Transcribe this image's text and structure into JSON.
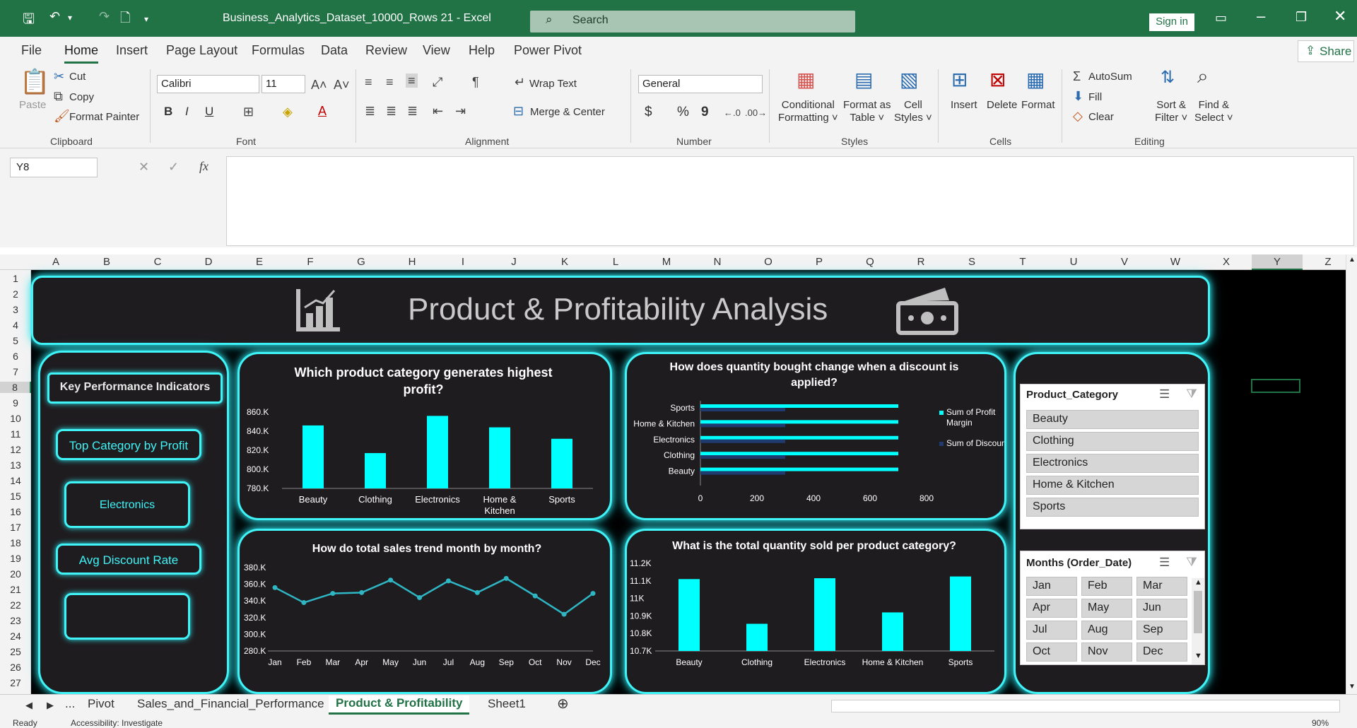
{
  "window": {
    "title": "Business_Analytics_Dataset_10000_Rows 21  -  Excel",
    "search": "Search",
    "signin": "Sign in",
    "share": "Share"
  },
  "menu": [
    "File",
    "Home",
    "Insert",
    "Page Layout",
    "Formulas",
    "Data",
    "Review",
    "View",
    "Help",
    "Power Pivot"
  ],
  "ribbon": {
    "clipboard": {
      "paste": "Paste",
      "cut": "Cut",
      "copy": "Copy",
      "format_painter": "Format Painter",
      "label": "Clipboard"
    },
    "font": {
      "name": "Calibri",
      "size": "11",
      "label": "Font",
      "bold": "B",
      "italic": "I",
      "underline": "U"
    },
    "alignment": {
      "wrap": "Wrap Text",
      "merge": "Merge & Center",
      "label": "Alignment"
    },
    "number": {
      "format": "General",
      "currency": "$",
      "percent": "%",
      "comma": "9",
      "label": "Number"
    },
    "styles": {
      "conditional": "Conditional",
      "conditional2": "Formatting",
      "format_as": "Format as",
      "format_as2": "Table",
      "cell_styles": "Cell",
      "cell_styles2": "Styles",
      "label": "Styles"
    },
    "cells": {
      "insert": "Insert",
      "delete": "Delete",
      "format": "Format",
      "label": "Cells"
    },
    "editing": {
      "autosum": "AutoSum",
      "fill": "Fill",
      "clear": "Clear",
      "sort": "Sort &",
      "sort2": "Filter",
      "find": "Find &",
      "find2": "Select",
      "label": "Editing"
    }
  },
  "namebox": "Y8",
  "fx": "fx",
  "columns": [
    "A",
    "B",
    "C",
    "D",
    "E",
    "F",
    "G",
    "H",
    "I",
    "J",
    "K",
    "L",
    "M",
    "N",
    "O",
    "P",
    "Q",
    "R",
    "S",
    "T",
    "U",
    "V",
    "W",
    "X",
    "Y",
    "Z"
  ],
  "rows": [
    "1",
    "2",
    "3",
    "4",
    "5",
    "6",
    "7",
    "8",
    "9",
    "10",
    "11",
    "12",
    "13",
    "14",
    "15",
    "16",
    "17",
    "18",
    "19",
    "20",
    "21",
    "22",
    "23",
    "24",
    "25",
    "26",
    "27"
  ],
  "dashboard": {
    "title": "Product & Profitability Analysis",
    "kpi_header": "Key Performance Indicators",
    "kpi1_label": "Top Category by Profit",
    "kpi1_value": "Electronics",
    "kpi2_label": "Avg Discount Rate",
    "kpi2_value": ""
  },
  "chart_data": [
    {
      "type": "bar",
      "title": "Which product category generates highest profit?",
      "categories": [
        "Beauty",
        "Clothing",
        "Electronics",
        "Home & Kitchen",
        "Sports"
      ],
      "values": [
        846000,
        817000,
        856000,
        844000,
        832000
      ],
      "yticks": [
        "860.K",
        "840.K",
        "820.K",
        "800.K",
        "780.K"
      ],
      "ylim": [
        780000,
        860000
      ],
      "color": "#00ffff"
    },
    {
      "type": "bar",
      "orientation": "horizontal",
      "title": "How does quantity bought change when a discount is applied?",
      "categories": [
        "Sports",
        "Home & Kitchen",
        "Electronics",
        "Clothing",
        "Beauty"
      ],
      "series": [
        {
          "name": "Sum of Profit Margin",
          "values": [
            700,
            700,
            700,
            700,
            700
          ],
          "color": "#00ffff"
        },
        {
          "name": "Sum of Discount_Rate",
          "values": [
            300,
            300,
            300,
            300,
            300
          ],
          "color": "#1f3a6e"
        }
      ],
      "xticks": [
        "0",
        "200",
        "400",
        "600",
        "800"
      ],
      "xlim": [
        0,
        800
      ],
      "legend": "right"
    },
    {
      "type": "line",
      "title": "How do total sales trend month by month?",
      "categories": [
        "Jan",
        "Feb",
        "Mar",
        "Apr",
        "May",
        "Jun",
        "Jul",
        "Aug",
        "Sep",
        "Oct",
        "Nov",
        "Dec"
      ],
      "values": [
        356000,
        338000,
        349000,
        350000,
        365000,
        344000,
        364000,
        350000,
        367000,
        346000,
        324000,
        349000
      ],
      "yticks": [
        "380.K",
        "360.K",
        "340.K",
        "320.K",
        "300.K",
        "280.K"
      ],
      "ylim": [
        280000,
        380000
      ],
      "color": "#2fb6c4"
    },
    {
      "type": "bar",
      "title": "What is the total quantity sold per product category?",
      "categories": [
        "Beauty",
        "Clothing",
        "Electronics",
        "Home & Kitchen",
        "Sports"
      ],
      "values": [
        11110,
        10855,
        11115,
        10920,
        11125
      ],
      "yticks": [
        "11.2K",
        "11.1K",
        "11K",
        "10.9K",
        "10.8K",
        "10.7K"
      ],
      "ylim": [
        10700,
        11200
      ],
      "color": "#00ffff"
    }
  ],
  "slicers": {
    "category": {
      "title": "Product_Category",
      "items": [
        "Beauty",
        "Clothing",
        "Electronics",
        "Home & Kitchen",
        "Sports"
      ]
    },
    "months": {
      "title": "Months (Order_Date)",
      "items": [
        "Jan",
        "Feb",
        "Mar",
        "Apr",
        "May",
        "Jun",
        "Jul",
        "Aug",
        "Sep",
        "Oct",
        "Nov",
        "Dec"
      ]
    }
  },
  "sheets": [
    "Pivot",
    "Sales_and_Financial_Performance",
    "Product & Profitability",
    "Sheet1"
  ],
  "status": {
    "ready": "Ready",
    "accessibility": "Accessibility: Investigate",
    "zoom": "90%"
  }
}
